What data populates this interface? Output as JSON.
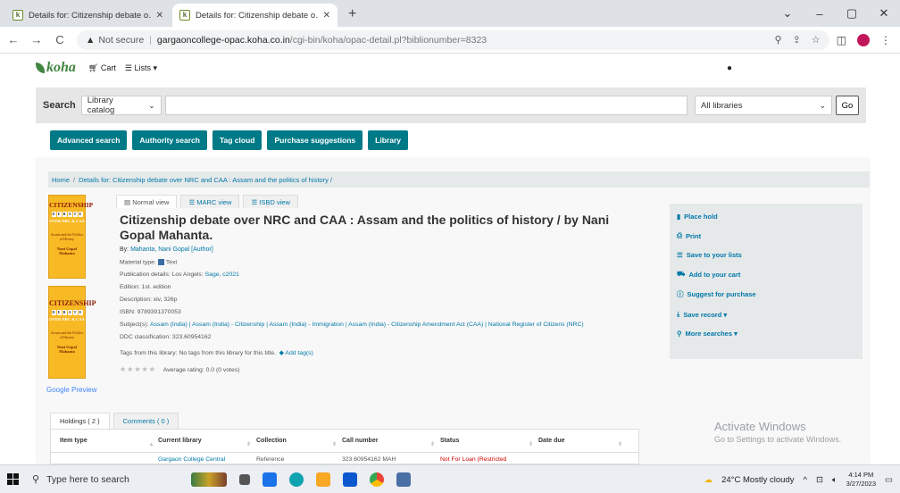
{
  "browser": {
    "tabs": [
      {
        "title": "Details for: Citizenship debate o…",
        "close": "✕"
      },
      {
        "title": "Details for: Citizenship debate o…",
        "close": "✕"
      }
    ],
    "new_tab": "+",
    "window_controls": {
      "dropdown": "⌄",
      "minimize": "–",
      "maximize": "▢",
      "close": "✕"
    },
    "nav": {
      "back": "←",
      "forward": "→",
      "reload": "C"
    },
    "address": {
      "not_secure": "Not secure",
      "separator": "|",
      "host": "gargaoncollege-opac.koha.co.in",
      "path": "/cgi-bin/koha/opac-detail.pl?biblionumber=8323"
    }
  },
  "koha": {
    "logo": "koha",
    "cart": "Cart",
    "lists": "Lists",
    "search": {
      "label": "Search",
      "type_select": "Library catalog",
      "library_select": "All libraries",
      "go": "Go"
    },
    "actions": [
      "Advanced search",
      "Authority search",
      "Tag cloud",
      "Purchase suggestions",
      "Library"
    ],
    "breadcrumb": {
      "home": "Home",
      "current": "Details for: Citizenship debate over NRC and CAA : Assam and the politics of history /"
    },
    "view_tabs": {
      "normal": "Normal view",
      "marc": "MARC view",
      "isbd": "ISBD view"
    },
    "record": {
      "title": "Citizenship debate over NRC and CAA : Assam and the politics of history / by Nani Gopal Mahanta.",
      "by_label": "By:",
      "author": "Mahanta, Nani Gopal [Author]",
      "material_label": "Material type:",
      "material_value": "Text",
      "publication_label": "Publication details:",
      "publication_place": "Los Angels:",
      "publication_link": "Sage, c2021",
      "edition": "Edition: 1st. edition",
      "description": "Description: xiv, 326p",
      "isbn": "ISBN: 9789391370053",
      "subjects_label": "Subject(s):",
      "subjects": "Assam (India) | Assam (India) - Citizenship | Assam (India) - Immigration | Assam (India) - Citizenship Amendment Act (CAA) | National Register of Citizens (NRC)",
      "ddc": "DDC classification: 323.60954162",
      "tags_text": "Tags from this library: No tags from this library for this title.",
      "add_tag": "Add tag(s)",
      "stars": "★★★★★",
      "rating": "Average rating: 0.0 (0 votes)"
    },
    "cover": {
      "line1": "CITIZENSHIP",
      "letters": [
        "D",
        "E",
        "B",
        "A",
        "T",
        "E"
      ],
      "line3": "OVER NRC & CAA",
      "line4": "Assam and the Politics of History",
      "line5": "Nani Gopal Mahanta",
      "google": "Google Preview"
    },
    "sidebar": [
      {
        "icon": "bookmark-icon",
        "label": "Place hold"
      },
      {
        "icon": "print-icon",
        "label": "Print"
      },
      {
        "icon": "list-icon",
        "label": "Save to your lists"
      },
      {
        "icon": "cart-icon",
        "label": "Add to your cart"
      },
      {
        "icon": "info-icon",
        "label": "Suggest for purchase"
      },
      {
        "icon": "download-icon",
        "label": "Save record ▾"
      },
      {
        "icon": "search-icon",
        "label": "More searches ▾"
      }
    ],
    "holdings_tabs": [
      "Holdings ( 2 )",
      "Comments ( 0 )"
    ],
    "holdings": {
      "headers": [
        "Item type",
        "Current library",
        "Collection",
        "Call number",
        "Status",
        "Date due"
      ],
      "row": [
        "",
        "Gargaon College Central",
        "Reference",
        "323.60954162 MAH",
        "Not For Loan (Restricted",
        ""
      ]
    }
  },
  "watermark": {
    "title": "Activate Windows",
    "subtitle": "Go to Settings to activate Windows."
  },
  "taskbar": {
    "search_placeholder": "Type here to search",
    "weather": "24°C  Mostly cloudy",
    "time": "4:14 PM",
    "date": "3/27/2023"
  }
}
